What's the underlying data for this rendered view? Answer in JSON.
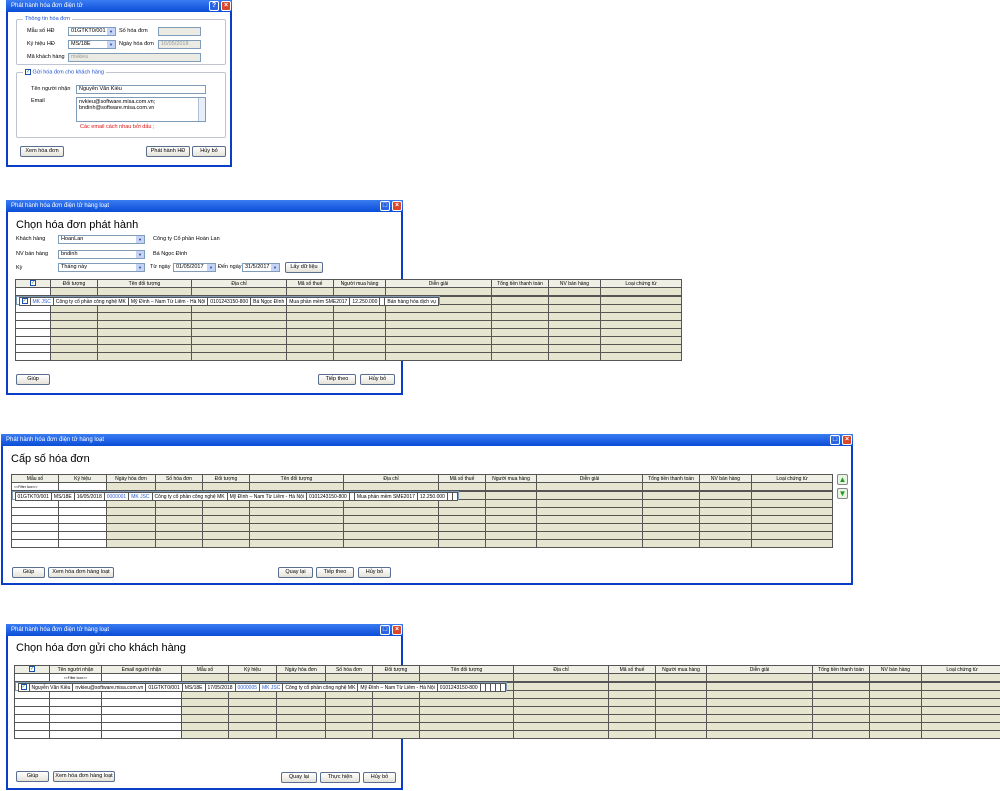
{
  "w1": {
    "title": "Phát hành hóa đơn điện tử",
    "help": "?",
    "close": "×",
    "group1": "Thông tin hóa đơn",
    "mau_so_label": "Mẫu số HĐ",
    "mau_so_val": "01GTKT0/001",
    "so_hd_label": "Số hóa đơn",
    "ky_hieu_label": "Ký hiệu HĐ",
    "ky_hieu_val": "MS/18E",
    "ngay_label": "Ngày hóa đơn",
    "ngay_val": "16/05/2018",
    "ma_kh_label": "Mã khách hàng",
    "ma_kh_val": "mvkieu",
    "group2": "Gửi hóa đơn cho khách hàng",
    "ten_nn_label": "Tên người nhận",
    "ten_nn_val": "Nguyễn Văn Kiều",
    "email_label": "Email",
    "email1": "nvkieu@software.misa.com.vn;",
    "email2": "bndinh@software.misa.com.vn",
    "hint": "Các email cách nhau bởi dấu ;",
    "btn_xem": "Xem hóa đơn",
    "btn_phat": "Phát hành HĐ",
    "btn_huy": "Hủy bỏ"
  },
  "w2": {
    "title": "Phát hành hóa đơn điện tử hàng loạt",
    "heading": "Chọn hóa đơn phát hành",
    "kh_label": "Khách hàng",
    "kh_val": "HoanLan",
    "kh_name": "Công ty Cổ phần Hoàn Lan",
    "nv_label": "NV bán hàng",
    "nv_val": "bndinh",
    "nv_name": "Bá Ngọc Đình",
    "ky_label": "Kỳ",
    "ky_val": "Tháng này",
    "tu_label": "Từ ngày",
    "tu_val": "01/05/2017",
    "den_label": "Đến ngày",
    "den_val": "31/5/2017",
    "btn_lay": "Lấy dữ liệu",
    "cols": [
      "Đối tượng",
      "Tên đối tượng",
      "Địa chỉ",
      "Mã số thuế",
      "Người mua hàng",
      "Diễn giải",
      "Tổng tiền thanh toán",
      "NV bán hàng",
      "Loại chứng từ"
    ],
    "row": [
      "MK JSC",
      "Công ty cổ phần công nghệ MK",
      "Mỹ Đình – Nam Từ Liêm - Hà Nội",
      "0101243150-800",
      "Bá Ngọc Đình",
      "Mua phần mềm SME2017",
      "12.250.000",
      "",
      "Bán hàng hóa dịch vụ"
    ],
    "btn_giup": "Giúp",
    "btn_tiep": "Tiếp theo",
    "btn_huy": "Hủy bỏ"
  },
  "w3": {
    "title": "Phát hành hóa đơn điện tử hàng loạt",
    "heading": "Cấp số hóa đơn",
    "filter": "<<Filter Icon>>",
    "cols": [
      "Mẫu số",
      "Ký hiệu",
      "Ngày hóa đơn",
      "Số hóa đơn",
      "Đối tượng",
      "Tên đối tượng",
      "Địa chỉ",
      "Mã số thuế",
      "Người mua hàng",
      "Diễn giải",
      "Tổng tiền thanh toán",
      "NV bán hàng",
      "Loại chứng từ"
    ],
    "row": [
      "01GTKT0/001",
      "MS/18E",
      "16/05/2018",
      "0000001",
      "MK JSC",
      "Công ty cổ phần công nghệ MK",
      "Mỹ Đình – Nam Từ Liêm - Hà Nội",
      "0101243150-800",
      "",
      "Mua phần mềm SME2017",
      "12.250.000",
      "",
      ""
    ],
    "btn_giup": "Giúp",
    "btn_xem": "Xem hóa đơn hàng loạt",
    "btn_quay": "Quay lại",
    "btn_tiep": "Tiếp theo",
    "btn_huy": "Hủy bỏ"
  },
  "w4": {
    "title": "Phát hành hóa đơn điện tử hàng loạt",
    "heading": "Chọn hóa đơn gửi cho khách hàng",
    "filter": "<<Filter Icon>>",
    "cols": [
      "Tên người nhận",
      "Email người nhận",
      "Mẫu số",
      "Ký hiệu",
      "Ngày hóa đơn",
      "Số hóa đơn",
      "Đối tượng",
      "Tên đối tượng",
      "Địa chỉ",
      "Mã số thuế",
      "Người mua hàng",
      "Diễn giải",
      "Tổng tiền thanh toán",
      "NV bán hàng",
      "Loại chứng từ"
    ],
    "row": [
      "Nguyễn Văn Kiều",
      "nvkieu@software.misa.com.vn",
      "01GTKT0/001",
      "MS/18E",
      "17/05/2018",
      "0000005",
      "MK JSC",
      "Công ty cổ phần công nghệ MK",
      "Mỹ Đình – Nam Từ Liêm - Hà Nội",
      "0101243150-800",
      "",
      "",
      "",
      "",
      ""
    ],
    "btn_giup": "Giúp",
    "btn_xem": "Xem hóa đơn hàng loạt",
    "btn_quay": "Quay lại",
    "btn_thuc": "Thực hiện",
    "btn_huy": "Hủy bỏ"
  }
}
